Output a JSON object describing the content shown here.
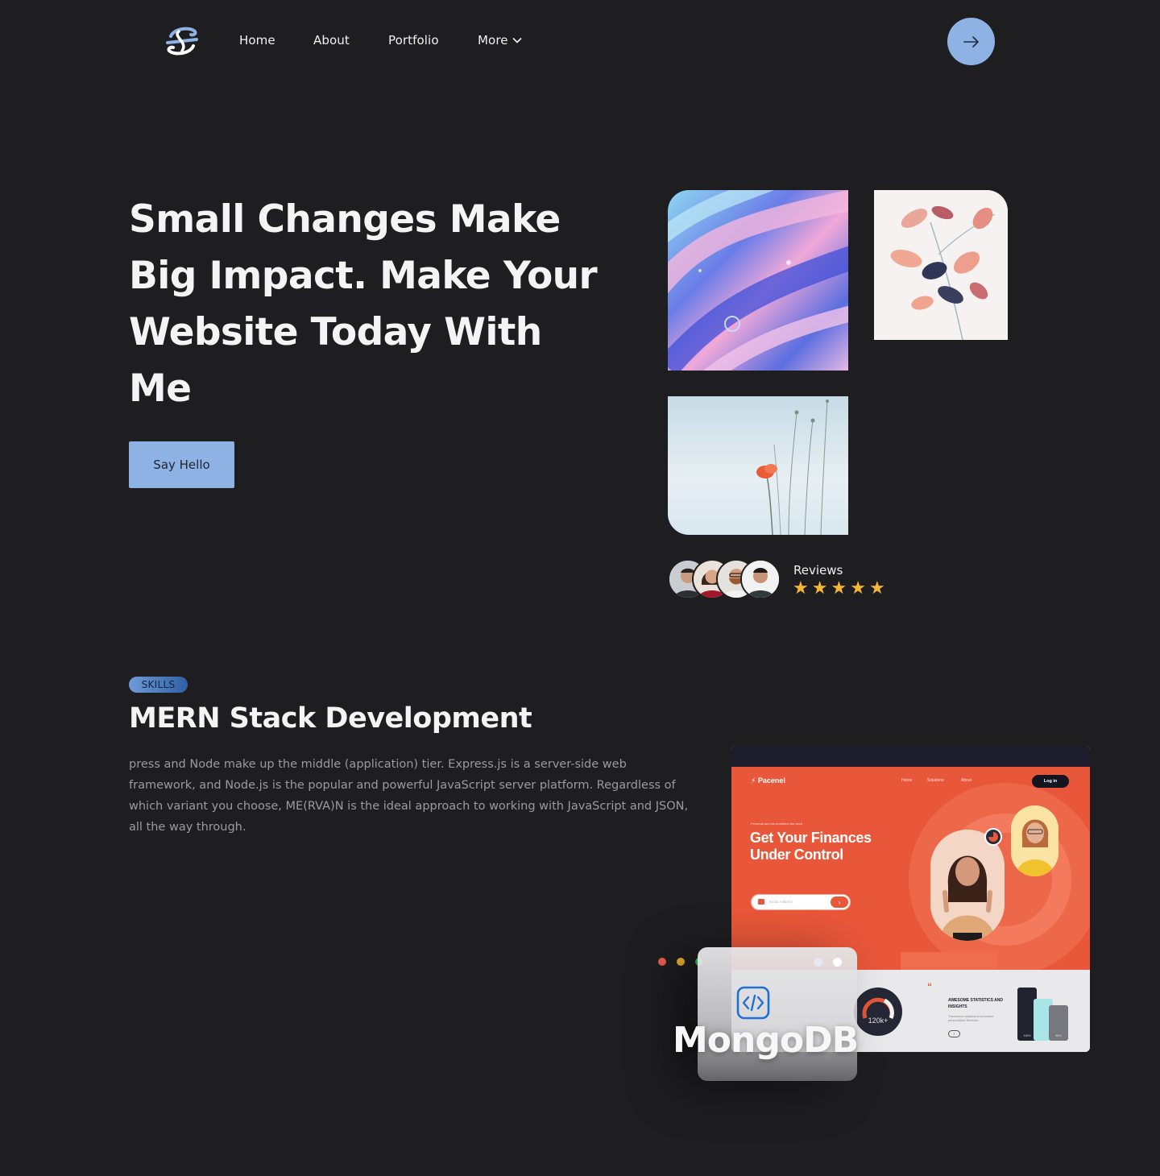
{
  "nav": {
    "links": [
      "Home",
      "About",
      "Portfolio"
    ],
    "more_label": "More",
    "logo_icon": "brand-logo-icon",
    "cta_icon": "arrow-right-icon"
  },
  "hero": {
    "title": "Small Changes Make Big Impact. Make Your Website Today With Me",
    "button_label": "Say Hello",
    "reviews_label": "Reviews",
    "stars": [
      "★",
      "★",
      "★",
      "★",
      "★"
    ],
    "rating": 5
  },
  "skills": {
    "badge": "SKILLS",
    "title": "MERN Stack Development",
    "description": "press and Node make up the middle (application) tier. Express.js is a server-side web framework, and Node.js is the popular and powerful JavaScript server platform. Regardless of which variant you choose, ME(RVA)N is the ideal approach to working with JavaScript and JSON, all the way through."
  },
  "mockup": {
    "brand": "Pacenel",
    "nav": [
      "Home",
      "Solutions",
      "About"
    ],
    "login": "Log in",
    "kicker": "Personal and trend without the word",
    "headline": "Get Your Finances Under Control",
    "input_placeholder": "Email Address",
    "gauge_value": "120k+",
    "stats_title": "AWESOME STATISTICS AND INSIGHTS",
    "stats_sub": "Transaction analysis for proactive personalized Services.",
    "bar_labels": [
      "100%",
      "50%",
      "80%"
    ]
  },
  "card": {
    "label": "MongoDB",
    "icon": "code-icon"
  },
  "colors": {
    "background": "#1e1e20",
    "accent": "#8db2e3",
    "star": "#f7b733",
    "mockup_orange": "#e9573a"
  }
}
